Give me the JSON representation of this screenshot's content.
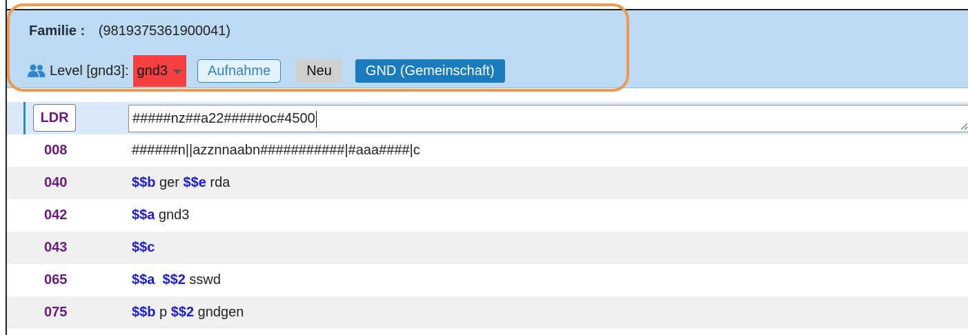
{
  "header": {
    "title_label": "Familie :",
    "record_id": "(9819375361900041)",
    "level_label": "Level [gnd3]:",
    "level_value": "gnd3",
    "buttons": {
      "aufnahme": "Aufnahme",
      "neu": "Neu",
      "gnd": "GND (Gemeinschaft)"
    }
  },
  "colors": {
    "header_bg": "#bcdaf1",
    "callout_border": "#f0984f",
    "level_select_bg": "#f44040",
    "primary_button": "#1a7bbd",
    "tag_color": "#6a1b7a",
    "subfield_color": "#1a1ad6"
  },
  "fields": [
    {
      "tag": "LDR",
      "value": "#####nz##a22#####oc#4500",
      "editing": true
    },
    {
      "tag": "008",
      "value": "######n||azznnaabn###########|#aaa####|c"
    },
    {
      "tag": "040",
      "parts": [
        {
          "sub": "$$b",
          "text": " ger "
        },
        {
          "sub": "$$e",
          "text": " rda"
        }
      ]
    },
    {
      "tag": "042",
      "parts": [
        {
          "sub": "$$a",
          "text": " gnd3"
        }
      ]
    },
    {
      "tag": "043",
      "parts": [
        {
          "sub": "$$c",
          "text": ""
        }
      ]
    },
    {
      "tag": "065",
      "parts": [
        {
          "sub": "$$a",
          "text": "  "
        },
        {
          "sub": "$$2",
          "text": " sswd"
        }
      ]
    },
    {
      "tag": "075",
      "parts": [
        {
          "sub": "$$b",
          "text": " p "
        },
        {
          "sub": "$$2",
          "text": " gndgen"
        }
      ]
    }
  ]
}
